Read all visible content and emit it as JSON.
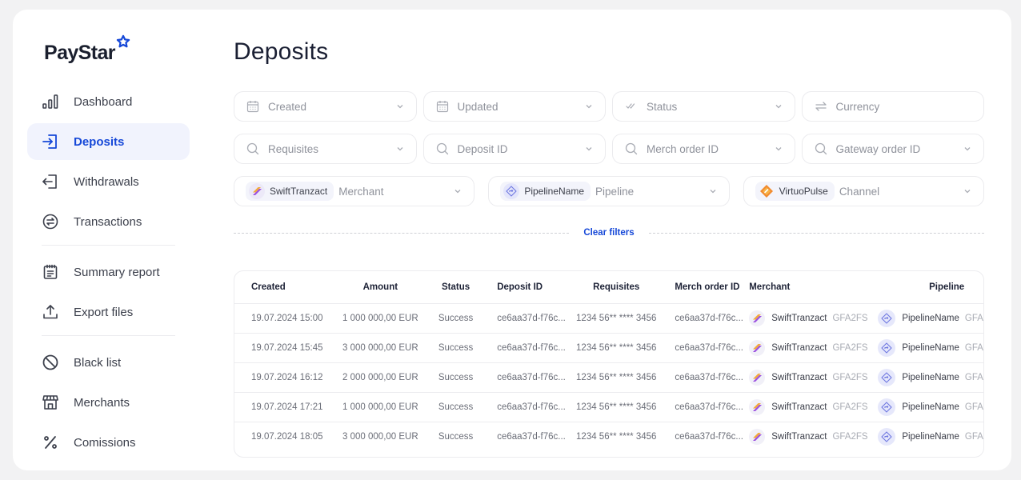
{
  "app": {
    "brand": "PayStar",
    "brand_color": "#1648d8"
  },
  "sidebar": {
    "items": [
      {
        "label": "Dashboard",
        "icon": "bar-chart-icon",
        "active": false
      },
      {
        "label": "Deposits",
        "icon": "deposit-in-icon",
        "active": true
      },
      {
        "label": "Withdrawals",
        "icon": "withdraw-out-icon",
        "active": false
      },
      {
        "label": "Transactions",
        "icon": "exchange-circle-icon",
        "active": false
      },
      {
        "label": "Summary report",
        "icon": "clipboard-icon",
        "active": false
      },
      {
        "label": "Export files",
        "icon": "upload-icon",
        "active": false
      },
      {
        "label": "Black list",
        "icon": "ban-icon",
        "active": false
      },
      {
        "label": "Merchants",
        "icon": "store-icon",
        "active": false
      },
      {
        "label": "Comissions",
        "icon": "percent-icon",
        "active": false
      }
    ]
  },
  "page": {
    "title": "Deposits"
  },
  "filters": {
    "row1": [
      {
        "placeholder": "Created",
        "icon": "calendar-icon"
      },
      {
        "placeholder": "Updated",
        "icon": "calendar-icon"
      },
      {
        "placeholder": "Status",
        "icon": "double-check-icon"
      },
      {
        "placeholder": "Currency",
        "icon": "swap-icon"
      }
    ],
    "row2": [
      {
        "placeholder": "Requisites",
        "icon": "search-icon"
      },
      {
        "placeholder": "Deposit ID",
        "icon": "search-icon"
      },
      {
        "placeholder": "Merch order ID",
        "icon": "search-icon"
      },
      {
        "placeholder": "Gateway order ID",
        "icon": "search-icon"
      }
    ],
    "row3": [
      {
        "chip": "SwiftTranzact",
        "placeholder": "Merchant"
      },
      {
        "chip": "PipelineName",
        "placeholder": "Pipeline"
      },
      {
        "chip": "VirtuoPulse",
        "placeholder": "Channel"
      }
    ],
    "clear_label": "Clear filters"
  },
  "table": {
    "headers": [
      "Created",
      "Amount",
      "Status",
      "Deposit ID",
      "Requisites",
      "Merch order ID",
      "Merchant",
      "Pipeline"
    ],
    "rows": [
      {
        "created": "19.07.2024 15:00",
        "amount": "1 000 000,00 EUR",
        "status": "Success",
        "deposit_id": "ce6aa37d-f76c...",
        "requisites": "1234 56** **** 3456",
        "merch_order_id": "ce6aa37d-f76c...",
        "merchant": "SwiftTranzact",
        "merchant_code": "GFA2FS",
        "pipeline": "PipelineName",
        "pipeline_code": "GFA"
      },
      {
        "created": "19.07.2024 15:45",
        "amount": "3 000 000,00 EUR",
        "status": "Success",
        "deposit_id": "ce6aa37d-f76c...",
        "requisites": "1234 56** **** 3456",
        "merch_order_id": "ce6aa37d-f76c...",
        "merchant": "SwiftTranzact",
        "merchant_code": "GFA2FS",
        "pipeline": "PipelineName",
        "pipeline_code": "GFA"
      },
      {
        "created": "19.07.2024 16:12",
        "amount": "2 000 000,00 EUR",
        "status": "Success",
        "deposit_id": "ce6aa37d-f76c...",
        "requisites": "1234 56** **** 3456",
        "merch_order_id": "ce6aa37d-f76c...",
        "merchant": "SwiftTranzact",
        "merchant_code": "GFA2FS",
        "pipeline": "PipelineName",
        "pipeline_code": "GFA"
      },
      {
        "created": "19.07.2024 17:21",
        "amount": "1 000 000,00 EUR",
        "status": "Success",
        "deposit_id": "ce6aa37d-f76c...",
        "requisites": "1234 56** **** 3456",
        "merch_order_id": "ce6aa37d-f76c...",
        "merchant": "SwiftTranzact",
        "merchant_code": "GFA2FS",
        "pipeline": "PipelineName",
        "pipeline_code": "GFA"
      },
      {
        "created": "19.07.2024 18:05",
        "amount": "3 000 000,00 EUR",
        "status": "Success",
        "deposit_id": "ce6aa37d-f76c...",
        "requisites": "1234 56** **** 3456",
        "merch_order_id": "ce6aa37d-f76c...",
        "merchant": "SwiftTranzact",
        "merchant_code": "GFA2FS",
        "pipeline": "PipelineName",
        "pipeline_code": "GFA"
      }
    ]
  }
}
